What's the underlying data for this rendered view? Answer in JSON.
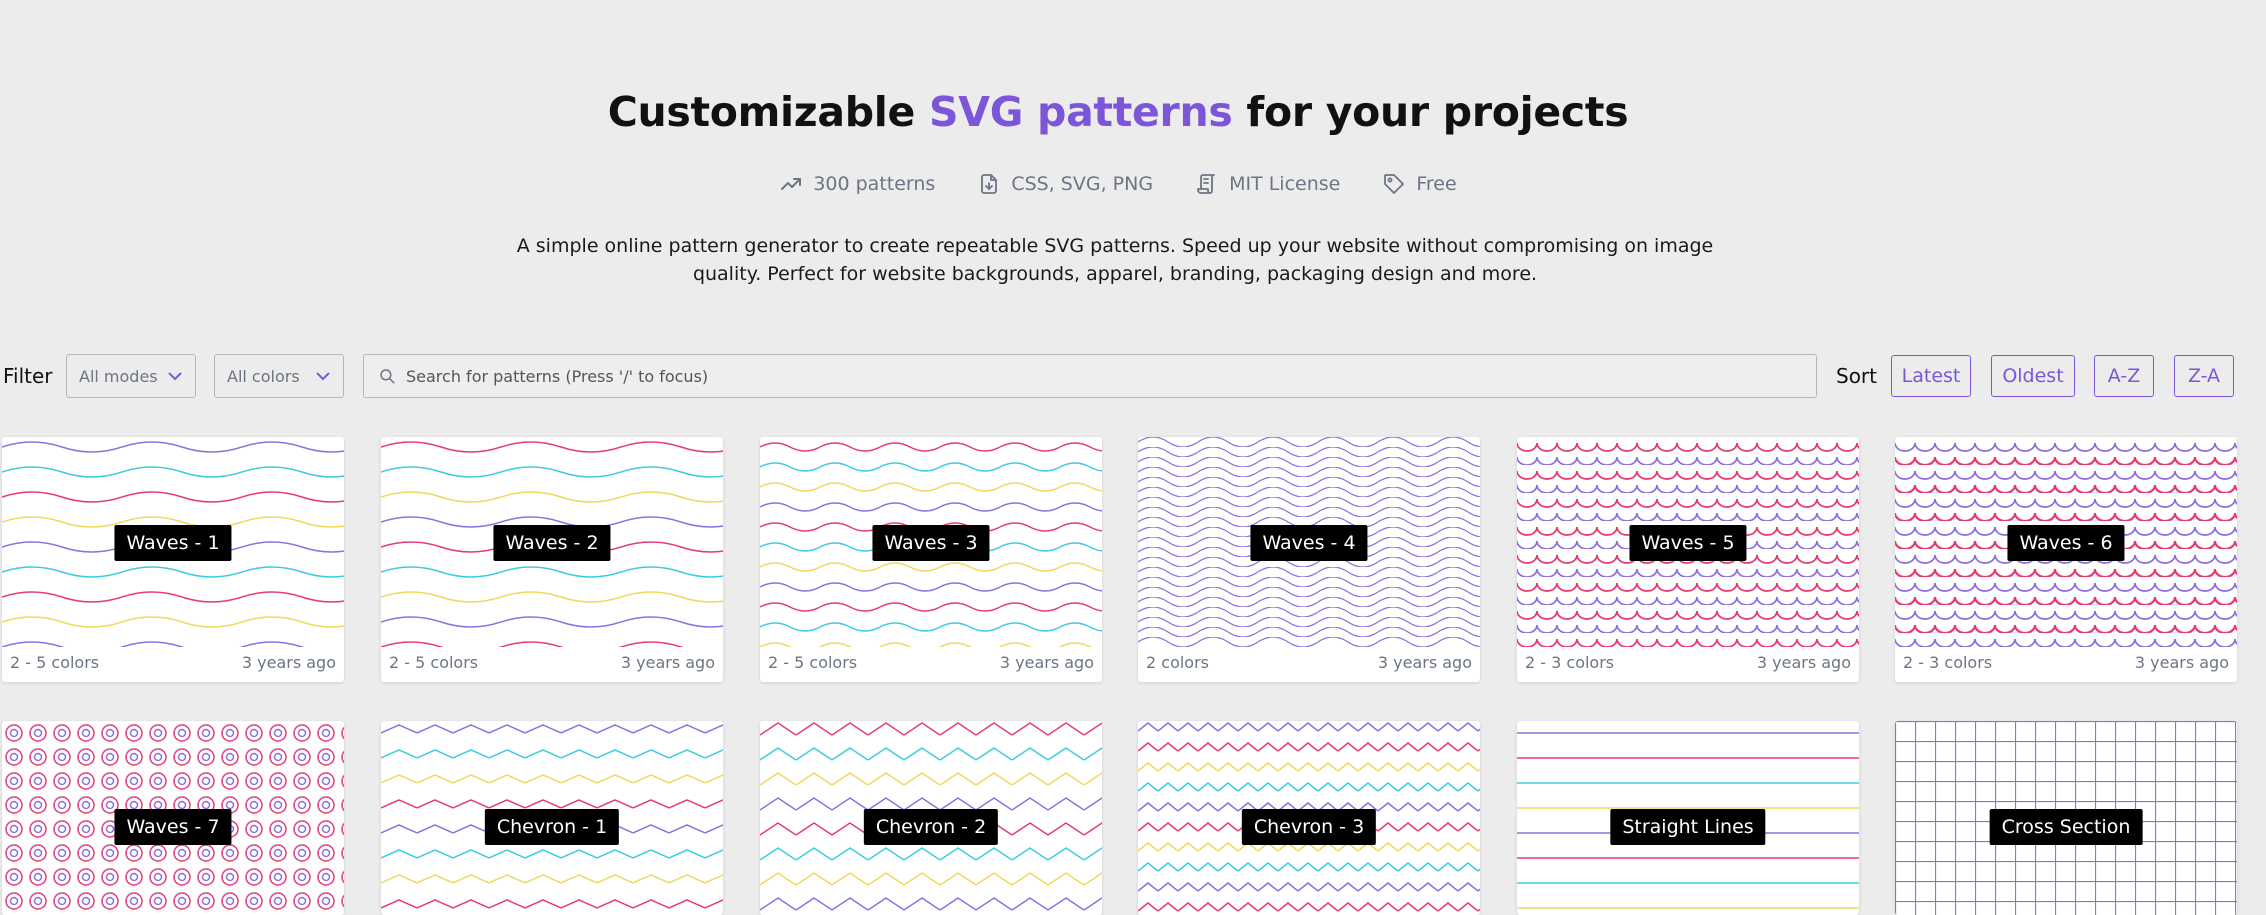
{
  "hero": {
    "title_before": "Customizable ",
    "title_accent": "SVG patterns",
    "title_after": " for your projects",
    "stats": [
      {
        "icon": "trending-up-icon",
        "label": "300 patterns"
      },
      {
        "icon": "file-download-icon",
        "label": "CSS, SVG, PNG"
      },
      {
        "icon": "license-icon",
        "label": "MIT License"
      },
      {
        "icon": "tag-icon",
        "label": "Free"
      }
    ],
    "description": "A simple online pattern generator to create repeatable SVG patterns. Speed up your website without compromising on image quality. Perfect for website backgrounds, apparel, branding, packaging design and more."
  },
  "filters": {
    "label": "Filter",
    "mode_select": "All modes",
    "color_select": "All colors",
    "search_placeholder": "Search for patterns (Press '/' to focus)",
    "search_value": "",
    "sort_label": "Sort",
    "sort_options": [
      "Latest",
      "Oldest",
      "A-Z",
      "Z-A"
    ]
  },
  "patterns": [
    {
      "name": "Waves - 1",
      "colors": "2 - 5 colors",
      "age": "3 years ago"
    },
    {
      "name": "Waves - 2",
      "colors": "2 - 5 colors",
      "age": "3 years ago"
    },
    {
      "name": "Waves - 3",
      "colors": "2 - 5 colors",
      "age": "3 years ago"
    },
    {
      "name": "Waves - 4",
      "colors": "2 colors",
      "age": "3 years ago"
    },
    {
      "name": "Waves - 5",
      "colors": "2 - 3 colors",
      "age": "3 years ago"
    },
    {
      "name": "Waves - 6",
      "colors": "2 - 3 colors",
      "age": "3 years ago"
    },
    {
      "name": "Waves - 7"
    },
    {
      "name": "Chevron - 1"
    },
    {
      "name": "Chevron - 2"
    },
    {
      "name": "Chevron - 3"
    },
    {
      "name": "Straight Lines"
    },
    {
      "name": "Cross Section"
    }
  ],
  "palette": {
    "accent": "#7c55d9",
    "purple": "#8f6fe0",
    "pink": "#e63b72",
    "cyan": "#3ccbe0",
    "yellow": "#f2d75a"
  }
}
